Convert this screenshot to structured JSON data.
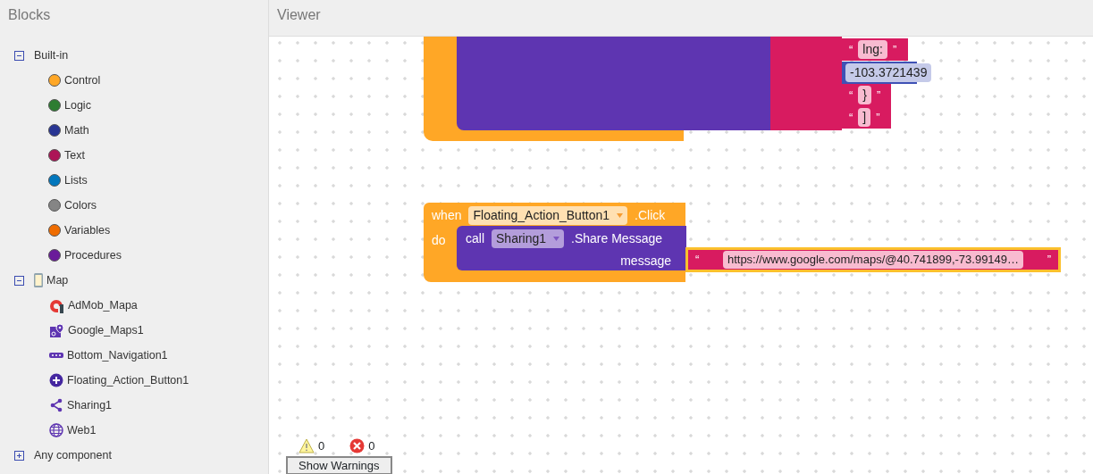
{
  "blocks_panel": {
    "title": "Blocks",
    "tree": [
      {
        "label": "Built-in",
        "expanded": true,
        "children": [
          {
            "label": "Control",
            "color": "#ffa726"
          },
          {
            "label": "Logic",
            "color": "#2e7d32"
          },
          {
            "label": "Math",
            "color": "#283593"
          },
          {
            "label": "Text",
            "color": "#ad1457"
          },
          {
            "label": "Lists",
            "color": "#0277bd"
          },
          {
            "label": "Colors",
            "color": "#858585"
          },
          {
            "label": "Variables",
            "color": "#ef6c00"
          },
          {
            "label": "Procedures",
            "color": "#6a1b9a"
          }
        ]
      },
      {
        "label": "Map",
        "expanded": true,
        "kind": "screen",
        "children": [
          {
            "label": "AdMob_Mapa",
            "kind": "admob"
          },
          {
            "label": "Google_Maps1",
            "kind": "map"
          },
          {
            "label": "Bottom_Navigation1",
            "kind": "navigation"
          },
          {
            "label": "Floating_Action_Button1",
            "kind": "fab"
          },
          {
            "label": "Sharing1",
            "kind": "sharing"
          },
          {
            "label": "Web1",
            "kind": "web"
          }
        ]
      },
      {
        "label": "Any component",
        "expanded": false
      }
    ]
  },
  "viewer": {
    "title": "Viewer",
    "upper_block": {
      "values": [
        {
          "kind": "text",
          "open": "“",
          "value": "lng:",
          "close": "”"
        },
        {
          "kind": "number",
          "value": "-103.3721439"
        },
        {
          "kind": "text",
          "open": "“",
          "value": "}",
          "close": "”"
        },
        {
          "kind": "text",
          "open": "“",
          "value": "]",
          "close": "”"
        }
      ]
    },
    "event_block": {
      "when": "when",
      "component": "Floating_Action_Button1",
      "event": ".Click",
      "do": "do",
      "call": {
        "keyword": "call",
        "component": "Sharing1",
        "method": ".Share Message",
        "argument_label": "message",
        "argument": {
          "open": "“",
          "value": "https://www.google.com/maps/@40.741899,-73.99149…",
          "close": "”",
          "selected": true
        }
      }
    },
    "warnings": {
      "warning_count": "0",
      "error_count": "0",
      "button": "Show Warnings"
    }
  }
}
